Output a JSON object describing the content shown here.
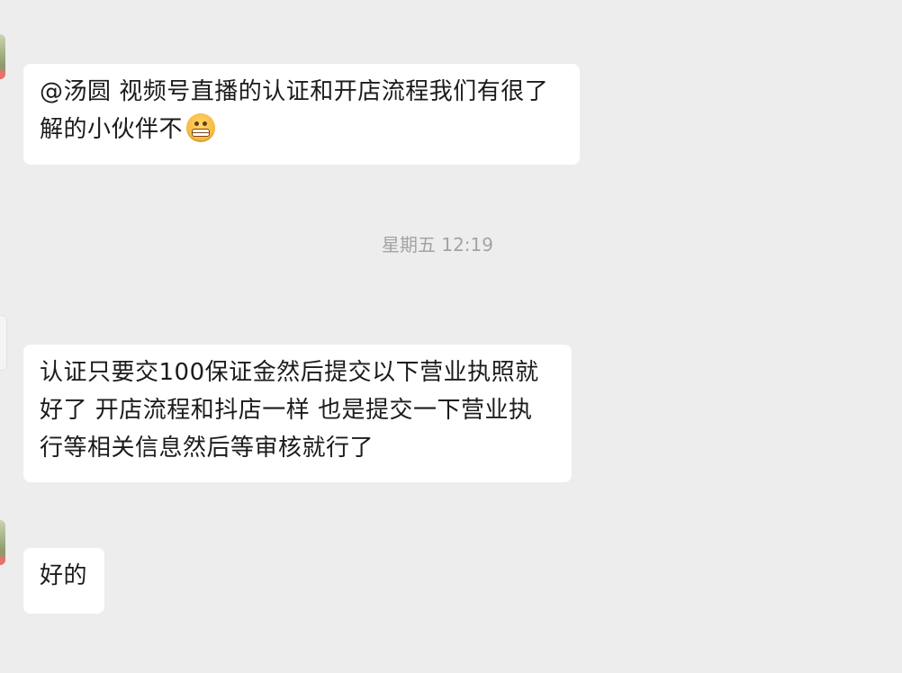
{
  "messages": [
    {
      "lines": [
        "@汤圆 视频号直播的认证和开店流程我们有很了",
        "解的小伙伴不"
      ],
      "emoji": "grimacing-emoji-icon"
    },
    {
      "lines": [
        "认证只要交100保证金然后提交以下营业执照就",
        "好了 开店流程和抖店一样  也是提交一下营业执",
        "行等相关信息然后等审核就行了"
      ]
    },
    {
      "lines": [
        "好的"
      ]
    }
  ],
  "timestamp": "星期五 12:19",
  "colors": {
    "background": "#ededed",
    "bubble": "#ffffff",
    "text": "#1b1b1b",
    "timestamp": "#a3a3a3"
  }
}
